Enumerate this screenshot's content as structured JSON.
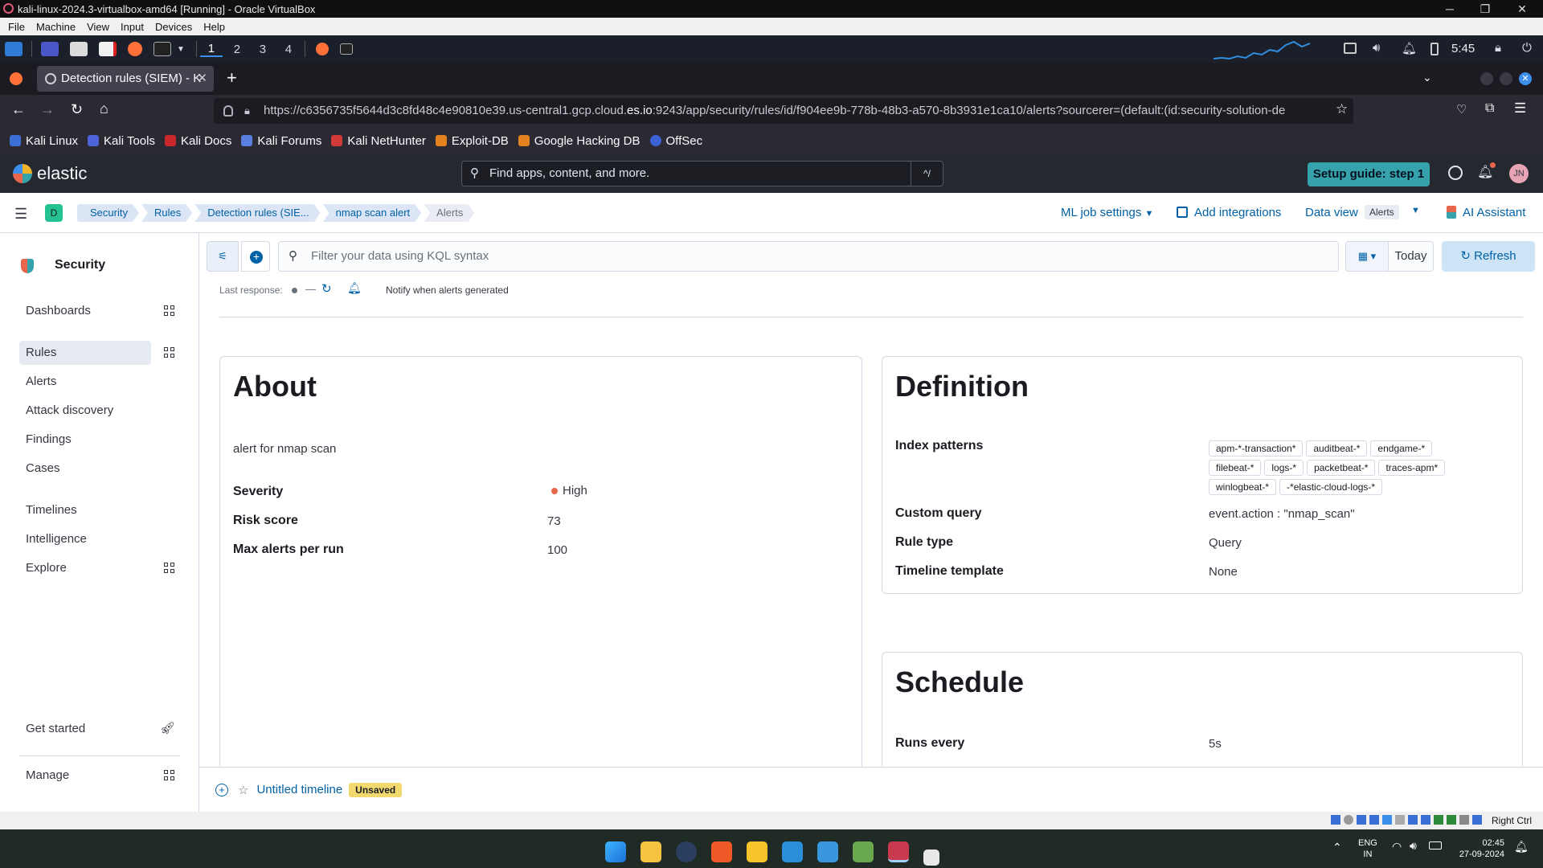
{
  "vbox": {
    "title": "kali-linux-2024.3-virtualbox-amd64 [Running] - Oracle VirtualBox",
    "menu": [
      "File",
      "Machine",
      "View",
      "Input",
      "Devices",
      "Help"
    ],
    "status_hostkey": "Right Ctrl"
  },
  "kali_panel": {
    "workspaces": [
      "1",
      "2",
      "3",
      "4"
    ],
    "clock": "5:45"
  },
  "firefox": {
    "tab_title": "Detection rules (SIEM) - K",
    "url_prefix": "https://c6356735f5644d3c8fd48c4e90810e39.us-central1.gcp.cloud.",
    "url_domain": "es.io",
    "url_rest": ":9243/app/security/rules/id/f904ee9b-778b-48b3-a570-8b3931e1ca10/alerts?sourcerer=(default:(id:security-solution-de",
    "bookmarks": [
      "Kali Linux",
      "Kali Tools",
      "Kali Docs",
      "Kali Forums",
      "Kali NetHunter",
      "Exploit-DB",
      "Google Hacking DB",
      "OffSec"
    ]
  },
  "kibana_header": {
    "brand": "elastic",
    "search_placeholder": "Find apps, content, and more.",
    "search_shortcut": "^/",
    "setup_guide": "Setup guide: step 1",
    "avatar": "JN"
  },
  "breadcrumbs": {
    "space": "D",
    "items": [
      "Security",
      "Rules",
      "Detection rules (SIE...",
      "nmap scan alert",
      "Alerts"
    ],
    "ml_job_settings": "ML job settings",
    "add_integrations": "Add integrations",
    "data_view_label": "Data view",
    "data_view_value": "Alerts",
    "ai_assistant": "AI Assistant"
  },
  "sidebar": {
    "title": "Security",
    "items": [
      "Dashboards",
      "Rules",
      "Alerts",
      "Attack discovery",
      "Findings",
      "Cases",
      "Timelines",
      "Intelligence",
      "Explore"
    ],
    "get_started": "Get started",
    "manage": "Manage"
  },
  "filter": {
    "kql_placeholder": "Filter your data using KQL syntax",
    "date": "Today",
    "refresh": "Refresh"
  },
  "status_row": {
    "last_response_label": "Last response:",
    "last_response_value": "—",
    "notify": "Notify when alerts generated"
  },
  "about": {
    "title": "About",
    "description": "alert for nmap scan",
    "severity_label": "Severity",
    "severity_value": "High",
    "risk_label": "Risk score",
    "risk_value": "73",
    "max_alerts_label": "Max alerts per run",
    "max_alerts_value": "100"
  },
  "definition": {
    "title": "Definition",
    "index_patterns_label": "Index patterns",
    "index_patterns": [
      "apm-*-transaction*",
      "auditbeat-*",
      "endgame-*",
      "filebeat-*",
      "logs-*",
      "packetbeat-*",
      "traces-apm*",
      "winlogbeat-*",
      "-*elastic-cloud-logs-*"
    ],
    "custom_query_label": "Custom query",
    "custom_query_value": "event.action : \"nmap_scan\"",
    "rule_type_label": "Rule type",
    "rule_type_value": "Query",
    "timeline_template_label": "Timeline template",
    "timeline_template_value": "None"
  },
  "schedule": {
    "title": "Schedule",
    "runs_every_label": "Runs every",
    "runs_every_value": "5s"
  },
  "timeline": {
    "name": "Untitled timeline",
    "status": "Unsaved"
  },
  "windows_taskbar": {
    "lang_top": "ENG",
    "lang_bottom": "IN",
    "time": "02:45",
    "date": "27-09-2024"
  },
  "colors": {
    "elastic_teal": "#36a2ab",
    "link_blue": "#0061a6",
    "severity_high": "#e7664c",
    "unsaved_badge": "#f1d86f"
  }
}
